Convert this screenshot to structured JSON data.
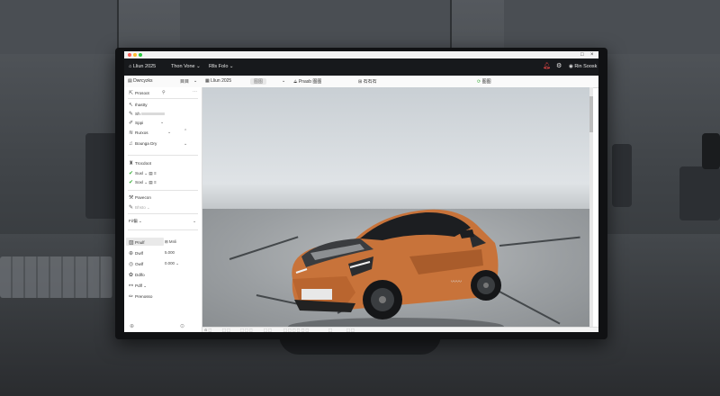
{
  "window": {
    "os_controls": [
      "□",
      "×"
    ]
  },
  "menubar": {
    "title": "Lliun 2025",
    "items": [
      "Thon Vone ⌄",
      "Rlls Folo ⌄"
    ],
    "user": "Rin Soosk"
  },
  "toolbar": {
    "panel_title": "Dwrcyzks",
    "panel_btn": "目目",
    "doc_title": "Lliun 2025",
    "pill": "图图",
    "action1": "Pnasb 图图",
    "action2": "石石石",
    "action3": "图图"
  },
  "panel": {
    "header": "Prosoot",
    "items": [
      {
        "label": "Ihastty",
        "icon": "pointer-icon"
      },
      {
        "label": "Sh",
        "icon": "pen-icon"
      },
      {
        "label": "Sppi",
        "icon": "brush-icon"
      },
      {
        "label": "Rurxos",
        "icon": "layers-icon"
      },
      {
        "label": "Bounga Dry",
        "icon": "music-icon"
      }
    ],
    "section2_title": "Trocdoot",
    "section2_items": [
      "Suxl",
      "Soxl"
    ],
    "section3_title": "Pavecon",
    "section3_sub": "Bhsto",
    "section3_sub2": "Fi/偏",
    "props": [
      {
        "label": "Pnulf",
        "value": "Mnli"
      },
      {
        "label": "Dwlf",
        "value": "5.000"
      },
      {
        "label": "Owlf",
        "value": "0.000"
      },
      {
        "label": "Ddlfo",
        "value": ""
      },
      {
        "label": "Pdlf",
        "value": ""
      },
      {
        "label": "Prenosso",
        "value": ""
      }
    ]
  },
  "statusbar": {
    "items": [
      "⊙ ⬚",
      "⬚ ⬚",
      "⬚ ⬚ ⬚",
      "⬚ ⬚",
      "⬚ ⬚ ⬚ ⬚ ⬚ ⬚",
      "⬚",
      "⬚ ⬚"
    ]
  },
  "colors": {
    "accent_green": "#3cae3c",
    "car_body": "#c8733a",
    "menubar_bg": "#17191c"
  }
}
